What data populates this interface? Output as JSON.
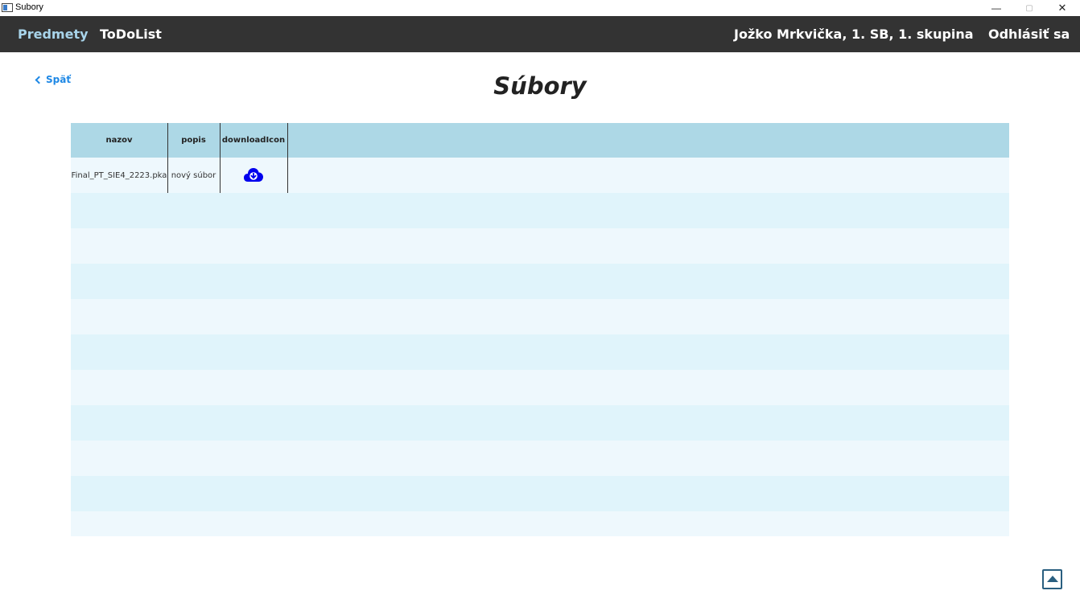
{
  "window": {
    "title": "Subory",
    "minimize_glyph": "—",
    "maximize_glyph": "▢",
    "close_glyph": "✕"
  },
  "nav": {
    "predmety": "Predmety",
    "todolist": "ToDoList",
    "user": "Jožko Mrkvička, 1. SB, 1. skupina",
    "logout": "Odhlásiť sa"
  },
  "back_label": "Späť",
  "page_title": "Súbory",
  "table": {
    "headers": [
      "nazov",
      "popis",
      "downloadIcon"
    ],
    "rows": [
      {
        "nazov": "Final_PT_SIE4_2223.pka",
        "popis": "nový súbor",
        "icon": "cloud-download-icon"
      }
    ]
  },
  "colors": {
    "navbar": "#333333",
    "nav_active": "#a8d4ea",
    "header_bg": "#add8e6",
    "row_alt": "#e0f4fb",
    "row_base": "#eef8fd",
    "download_icon": "#0000ee",
    "back_link": "#1e88e5"
  },
  "icons": {
    "scroll_top": "arrow-up-square-icon",
    "back": "chevron-left-icon"
  }
}
